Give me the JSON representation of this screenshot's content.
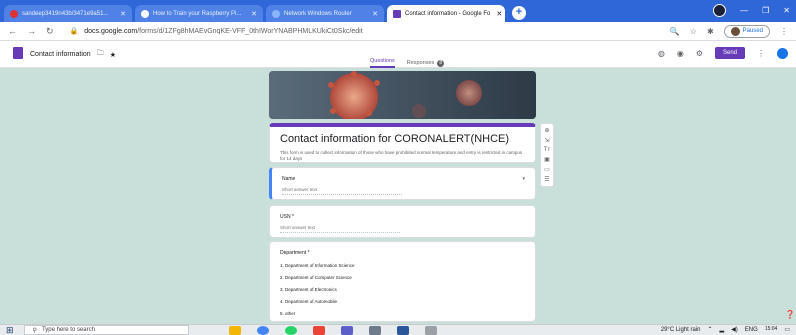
{
  "browser": {
    "tabs": [
      {
        "label": "sandeep3419n43b/3471e9a51...",
        "fav": "#d33",
        "active": false
      },
      {
        "label": "How to Train your Raspberry Pi...",
        "fav": "#fff",
        "active": false
      },
      {
        "label": "Network Windows Router",
        "fav": "#8ab4f8",
        "active": false
      },
      {
        "label": "Contact information - Google Fo",
        "fav": "#673ab7",
        "active": true
      }
    ],
    "url_domain": "docs.google.com",
    "url_path": "/forms/d/1ZFg8hMAEvGnqKE-VFF_0thIWorYNABPHMLKUkiCt0Skc/edit",
    "paused_label": "Paused"
  },
  "forms_header": {
    "title": "Contact information",
    "tab_questions": "Questions",
    "tab_responses": "Responses",
    "responses_count": "8",
    "send_label": "Send"
  },
  "form": {
    "title": "Contact information for CORONALERT(NHCE)",
    "description": "This form is used to collect information of those who have prohibited normal temperature and entry is restricted in campus for 14 days",
    "questions": [
      {
        "label": "Name",
        "placeholder": "Short answer text"
      },
      {
        "label": "USN *",
        "placeholder": "Short answer text"
      }
    ],
    "department": {
      "label": "Department *",
      "options": [
        "1. Department of Information Science",
        "2. Department of Computer Science",
        "3. Department of Electronics",
        "4. Department of Automobile",
        "5. other"
      ]
    }
  },
  "taskbar": {
    "search_placeholder": "Type here to search",
    "weather": "29°C  Light rain",
    "lang": "ENG",
    "time": "15:04"
  }
}
